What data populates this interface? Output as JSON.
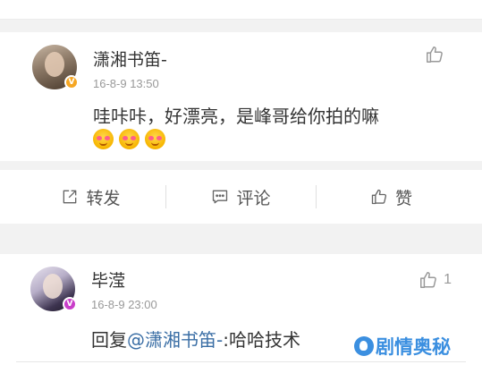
{
  "comments": [
    {
      "username": "潇湘书笛-",
      "timestamp": "16-8-9 13:50",
      "text": "哇咔咔，好漂亮，是峰哥给你拍的嘛",
      "emojis": [
        "blush-emoji",
        "blush-emoji",
        "blush-emoji"
      ],
      "badge": "V",
      "badge_color": "#f5a623",
      "like_count": ""
    },
    {
      "username": "毕滢",
      "timestamp": "16-8-9 23:00",
      "reply_prefix": "回复",
      "mention": "@潇湘书笛-",
      "text": ":哈哈技术",
      "badge": "V",
      "badge_color": "#c93ec9",
      "like_count": "1"
    }
  ],
  "actions": {
    "repost_label": "转发",
    "comment_label": "评论",
    "like_label": "赞"
  },
  "watermark": "剧情奥秘",
  "colors": {
    "mention": "#3a6ea5",
    "muted": "#999999",
    "band": "#f2f2f2"
  }
}
